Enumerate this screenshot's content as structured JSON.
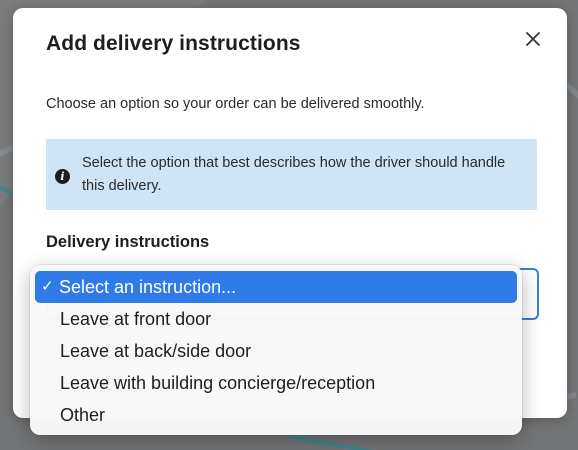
{
  "modal": {
    "title": "Add delivery instructions",
    "close_icon": "close-icon",
    "subtitle": "Choose an option so your order can be delivered smoothly.",
    "info": {
      "icon": "info-icon",
      "text": "Select the option that best describes how the driver should handle this delivery."
    },
    "field_label": "Delivery instructions"
  },
  "dropdown": {
    "selected_index": 0,
    "check_mark": "✓",
    "options": [
      "Select an instruction...",
      "Leave at front door",
      "Leave at back/side door",
      "Leave with building concierge/reception",
      "Other"
    ]
  },
  "colors": {
    "accent": "#2f7ce8",
    "info_bg": "#cfe5f5",
    "select_border": "#3b7fd4"
  }
}
